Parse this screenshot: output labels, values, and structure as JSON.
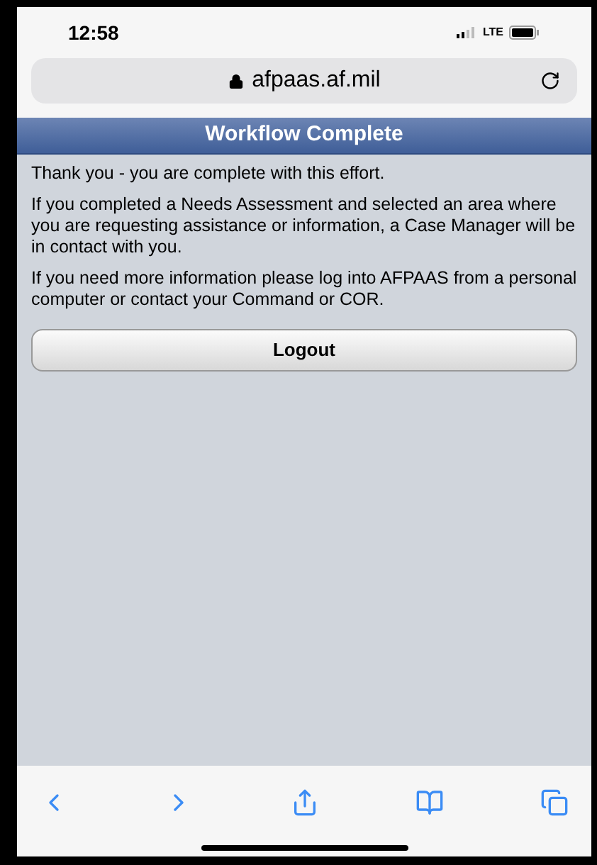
{
  "status_bar": {
    "time": "12:58",
    "network": "LTE"
  },
  "address_bar": {
    "url": "afpaas.af.mil"
  },
  "header": {
    "title": "Workflow Complete"
  },
  "paragraphs": [
    "Thank you - you are complete with this effort.",
    "If you completed a Needs Assessment and selected an area where you are requesting assistance or information, a Case Manager will be in contact with you.",
    "If you need more information please log into AFPAAS from a personal computer or contact your Command or COR."
  ],
  "logout_button": {
    "label": "Logout"
  }
}
